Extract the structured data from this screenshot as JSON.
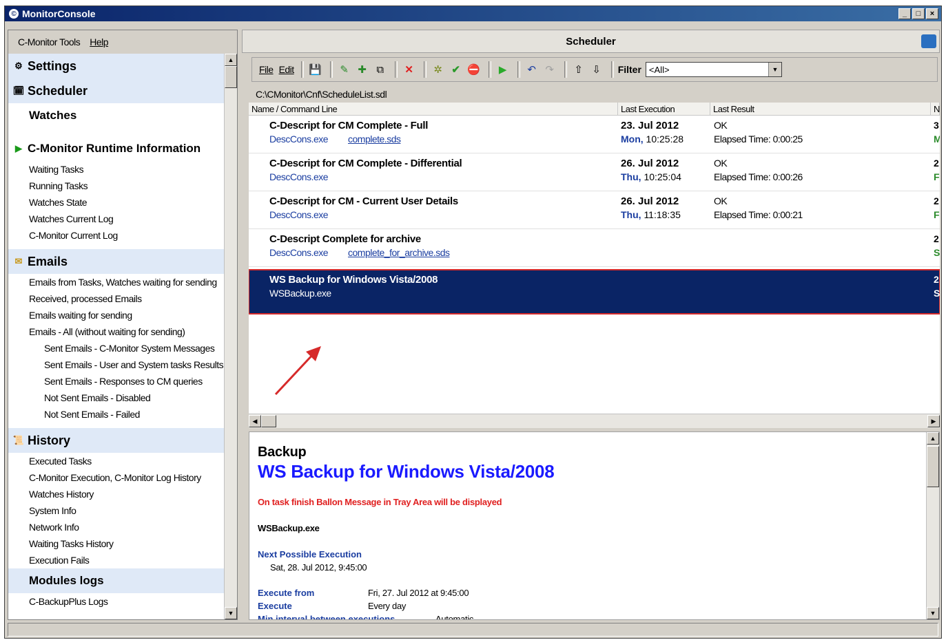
{
  "window": {
    "title": "MonitorConsole",
    "buttons": [
      "_",
      "□",
      "×"
    ]
  },
  "menu": {
    "tools": "C-Monitor Tools",
    "help": "Help"
  },
  "nav": {
    "settings": "Settings",
    "scheduler": "Scheduler",
    "watches": "Watches",
    "runtime": "C-Monitor Runtime Information",
    "runtime_items": [
      "Waiting Tasks",
      "Running Tasks",
      "Watches State",
      "Watches Current Log",
      "C-Monitor Current Log"
    ],
    "emails": "Emails",
    "email_items": [
      "Emails from Tasks, Watches waiting for sending",
      "Received, processed Emails",
      "Emails waiting for sending",
      "Emails - All (without waiting for sending)"
    ],
    "email_subitems": [
      "Sent Emails - C-Monitor System Messages",
      "Sent Emails - User and System tasks Results",
      "Sent Emails - Responses to CM queries",
      "Not Sent Emails - Disabled",
      "Not Sent Emails - Failed"
    ],
    "history": "History",
    "history_items": [
      "Executed Tasks",
      "C-Monitor Execution, C-Monitor Log History",
      "Watches History",
      "System Info",
      "Network Info",
      "Waiting Tasks History",
      "Execution Fails"
    ],
    "modules": "Modules logs",
    "module_items": [
      "C-BackupPlus Logs"
    ]
  },
  "scheduler": {
    "title": "Scheduler",
    "toolbar": {
      "file": "File",
      "edit": "Edit",
      "filter_label": "Filter",
      "filter_value": "<All>"
    },
    "path": "C:\\CMonitor\\Cnf\\ScheduleList.sdl",
    "columns": [
      "Name / Command Line",
      "Last Execution",
      "Last Result",
      "N"
    ],
    "rows": [
      {
        "name": "C-Descript for CM Complete - Full",
        "cmd": "DescCons.exe",
        "arg": "complete.sds",
        "date": "23. Jul 2012",
        "day": "Mon,",
        "time": "10:25:28",
        "result": "OK",
        "elapsed": "Elapsed Time: 0:00:25",
        "n1": "3",
        "n2": "M"
      },
      {
        "name": "C-Descript for CM Complete - Differential",
        "cmd": "DescCons.exe",
        "arg": "",
        "date": "26. Jul 2012",
        "day": "Thu,",
        "time": "10:25:04",
        "result": "OK",
        "elapsed": "Elapsed Time: 0:00:26",
        "n1": "2",
        "n2": "F"
      },
      {
        "name": "C-Descript for CM - Current User Details",
        "cmd": "DescCons.exe",
        "arg": "",
        "date": "26. Jul 2012",
        "day": "Thu,",
        "time": "11:18:35",
        "result": "OK",
        "elapsed": "Elapsed Time: 0:00:21",
        "n1": "2",
        "n2": "F"
      },
      {
        "name": "C-Descript Complete for archive",
        "cmd": "DescCons.exe",
        "arg": "complete_for_archive.sds",
        "date": "",
        "day": "",
        "time": "",
        "result": "",
        "elapsed": "",
        "n1": "2",
        "n2": "S"
      },
      {
        "name": "WS Backup for Windows Vista/2008",
        "cmd": "WSBackup.exe",
        "arg": "",
        "date": "",
        "day": "",
        "time": "",
        "result": "",
        "elapsed": "",
        "n1": "2",
        "n2": "S"
      }
    ]
  },
  "detail": {
    "category": "Backup",
    "title": "WS Backup for Windows Vista/2008",
    "warning": "On task finish Ballon Message in Tray Area will be displayed",
    "exe": "WSBackup.exe",
    "next_label": "Next Possible Execution",
    "next_value": "Sat, 28. Jul 2012, 9:45:00",
    "from_label": "Execute from",
    "from_value": "Fri, 27. Jul 2012 at 9:45:00",
    "execute_label": "Execute",
    "execute_value": "Every day",
    "interval_label": "Min interval between executions",
    "interval_value": "Automatic"
  },
  "colors": {
    "accent": "#0a2465",
    "link": "#1a3da0",
    "warning": "#e02020",
    "highlight": "#d62a2a",
    "title_blue": "#1a1aff"
  }
}
